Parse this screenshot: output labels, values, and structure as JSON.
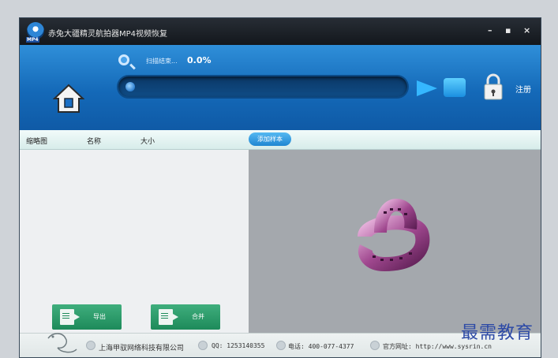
{
  "window": {
    "title": "赤兔大疆精灵航拍器MP4视频恢复",
    "app_icon_badge": "MP4",
    "controls": {
      "minimize": "–",
      "maximize": "▪",
      "close": "×"
    }
  },
  "header": {
    "scan_status_label": "扫描结束...",
    "scan_percent": "0.0%",
    "progress_fraction": 0.0,
    "register_label": "注册",
    "accent_color": "#1469b8"
  },
  "columns": [
    "缩略图",
    "名称",
    "大小"
  ],
  "add_sample_button": "添加样本",
  "buttons": {
    "export": "导出",
    "merge": "合并"
  },
  "status_bar": {
    "company": "上海甲驭网络科技有限公司",
    "qq": "QQ: 1253140355",
    "phone": "电话: 400-077-4377",
    "website": "官方网址: http://www.sysrin.cn"
  },
  "watermark": "最需教育"
}
